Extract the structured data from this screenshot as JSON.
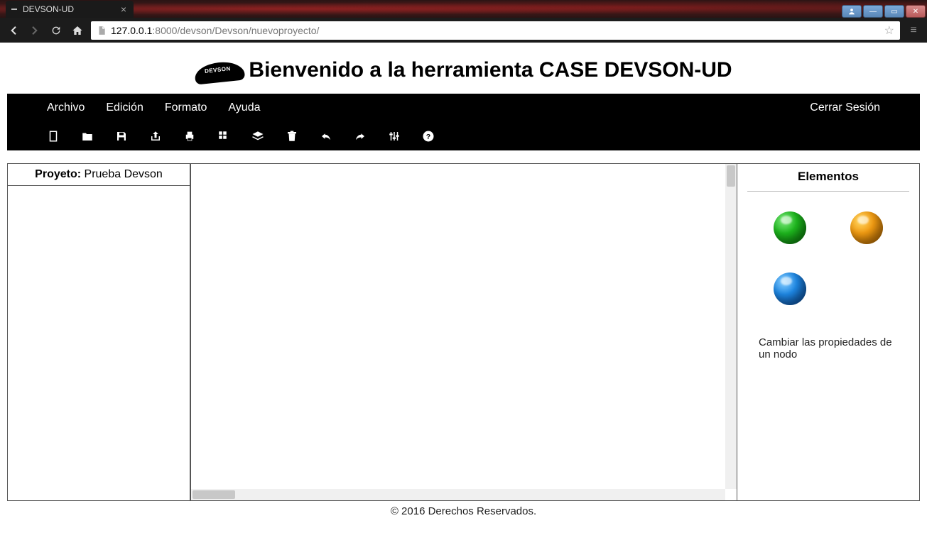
{
  "browser": {
    "tab_title": "DEVSON-UD",
    "url_host": "127.0.0.1",
    "url_port": ":8000",
    "url_path": "/devson/Devson/nuevoproyecto/"
  },
  "header": {
    "logo_text": "DEVSON",
    "title": "Bienvenido a la herramienta CASE DEVSON-UD"
  },
  "menu": {
    "items": [
      "Archivo",
      "Edición",
      "Formato",
      "Ayuda"
    ],
    "logout": "Cerrar Sesión"
  },
  "toolbar_icons": [
    "new-file-icon",
    "open-folder-icon",
    "save-icon",
    "share-icon",
    "print-icon",
    "grid-icon",
    "layers-icon",
    "delete-icon",
    "undo-icon",
    "redo-icon",
    "settings-sliders-icon",
    "help-icon"
  ],
  "left_panel": {
    "label": "Proyeto:",
    "project_name": "Prueba Devson"
  },
  "right_panel": {
    "title": "Elementos",
    "elements": [
      {
        "name": "element-g",
        "color": "green"
      },
      {
        "name": "element-s",
        "color": "orange"
      },
      {
        "name": "element-r",
        "color": "blue"
      }
    ],
    "note": "Cambiar las propiedades de un nodo"
  },
  "footer": "© 2016 Derechos Reservados."
}
